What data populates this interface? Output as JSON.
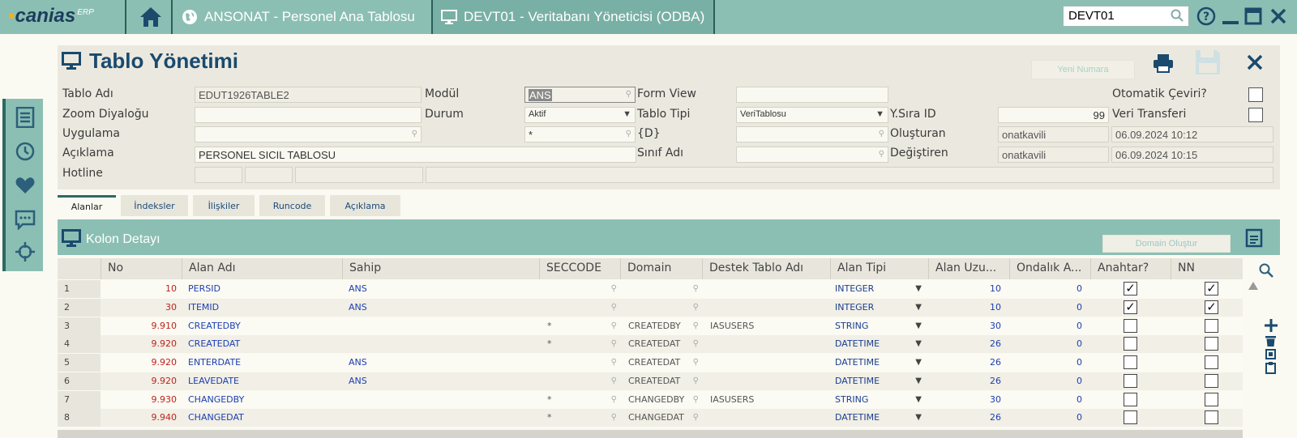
{
  "app": {
    "logo_text": "canias",
    "logo_sup": "ERP",
    "tabs": [
      {
        "label": "ANSONAT - Personel Ana Tablosu"
      },
      {
        "label": "DEVT01 - Veritabanı Yöneticisi (ODBA)"
      }
    ],
    "search_value": "DEVT01"
  },
  "form": {
    "title": "Tablo Yönetimi",
    "new_number_label": "Yeni Numara",
    "labels": {
      "tablo_adi": "Tablo Adı",
      "zoom": "Zoom Diyaloğu",
      "uygulama": "Uygulama",
      "aciklama": "Açıklama",
      "hotline": "Hotline",
      "modul": "Modül",
      "durum": "Durum",
      "form_view": "Form View",
      "tablo_tipi": "Tablo Tipi",
      "d": "{D}",
      "sinif_adi": "Sınıf Adı",
      "ysira": "Y.Sıra ID",
      "olusturan": "Oluşturan",
      "degistiren": "Değiştiren",
      "oto_ceviri": "Otomatik Çeviri?",
      "veri_transferi": "Veri Transferi"
    },
    "values": {
      "tablo_adi": "EDUT1926TABLE2",
      "aciklama": "PERSONEL SICIL TABLOSU",
      "modul": "ANS",
      "durum": "Aktif",
      "uygulama2": "*",
      "tablo_tipi": "VeriTablosu",
      "ysira": "99",
      "olusturan": "onatkavili",
      "olusturan_tarih": "06.09.2024 10:12",
      "degistiren": "onatkavili",
      "degistiren_tarih": "06.09.2024 10:15"
    }
  },
  "tabs": [
    {
      "label": "Alanlar"
    },
    {
      "label": "İndeksler"
    },
    {
      "label": "İlişkiler"
    },
    {
      "label": "Runcode"
    },
    {
      "label": "Açıklama"
    }
  ],
  "grid": {
    "title": "Kolon Detayı",
    "domain_button": "Domain Oluştur",
    "columns": [
      "No",
      "Alan Adı",
      "Sahip",
      "SECCODE",
      "Domain",
      "Destek Tablo Adı",
      "Alan Tipi",
      "Alan Uzu...",
      "Ondalık A...",
      "Anahtar?",
      "NN"
    ],
    "rows": [
      {
        "n": "1",
        "no": "10",
        "alan": "PERSID",
        "sahip": "ANS",
        "sec": "",
        "domain": "",
        "destek": "",
        "tip": "INTEGER",
        "uzun": "10",
        "ond": "0",
        "key": true,
        "nn": true
      },
      {
        "n": "2",
        "no": "30",
        "alan": "ITEMID",
        "sahip": "ANS",
        "sec": "",
        "domain": "",
        "destek": "",
        "tip": "INTEGER",
        "uzun": "10",
        "ond": "0",
        "key": true,
        "nn": true
      },
      {
        "n": "3",
        "no": "9.910",
        "alan": "CREATEDBY",
        "sahip": "",
        "sec": "*",
        "domain": "CREATEDBY",
        "destek": "IASUSERS",
        "tip": "STRING",
        "uzun": "30",
        "ond": "0",
        "key": false,
        "nn": false
      },
      {
        "n": "4",
        "no": "9.920",
        "alan": "CREATEDAT",
        "sahip": "",
        "sec": "*",
        "domain": "CREATEDAT",
        "destek": "",
        "tip": "DATETIME",
        "uzun": "26",
        "ond": "0",
        "key": false,
        "nn": false
      },
      {
        "n": "5",
        "no": "9.920",
        "alan": "ENTERDATE",
        "sahip": "ANS",
        "sec": "",
        "domain": "CREATEDAT",
        "destek": "",
        "tip": "DATETIME",
        "uzun": "26",
        "ond": "0",
        "key": false,
        "nn": false
      },
      {
        "n": "6",
        "no": "9.920",
        "alan": "LEAVEDATE",
        "sahip": "ANS",
        "sec": "",
        "domain": "CREATEDAT",
        "destek": "",
        "tip": "DATETIME",
        "uzun": "26",
        "ond": "0",
        "key": false,
        "nn": false
      },
      {
        "n": "7",
        "no": "9.930",
        "alan": "CHANGEDBY",
        "sahip": "",
        "sec": "*",
        "domain": "CHANGEDBY",
        "destek": "IASUSERS",
        "tip": "STRING",
        "uzun": "30",
        "ond": "0",
        "key": false,
        "nn": false
      },
      {
        "n": "8",
        "no": "9.940",
        "alan": "CHANGEDAT",
        "sahip": "",
        "sec": "*",
        "domain": "CHANGEDAT",
        "destek": "",
        "tip": "DATETIME",
        "uzun": "26",
        "ond": "0",
        "key": false,
        "nn": false
      }
    ]
  },
  "colors": {
    "topbar": "#8bbfb3",
    "accent_dark": "#2b6a64",
    "title_blue": "#1a4a6e",
    "number_red": "#c0221c",
    "value_blue": "#1c3fb0"
  }
}
